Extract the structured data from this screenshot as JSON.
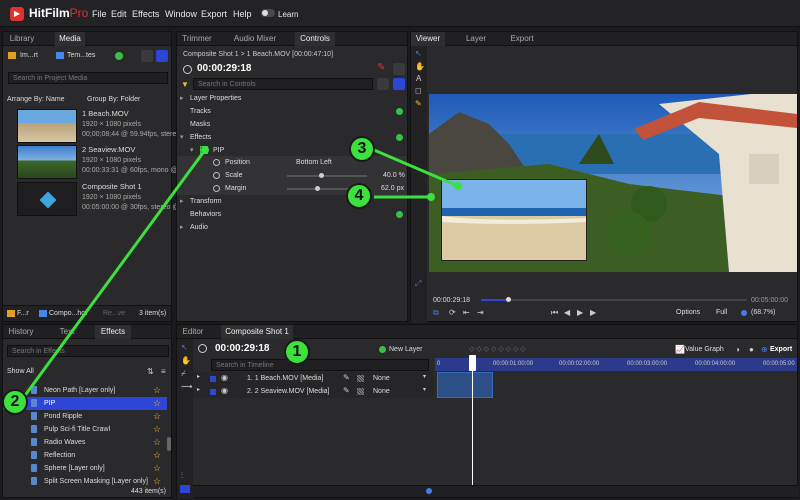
{
  "app": {
    "name": "HitFilm",
    "edition": "Pro",
    "logo_glyph": "▶"
  },
  "menu": [
    "File",
    "Edit",
    "Effects",
    "Window",
    "Export",
    "Help"
  ],
  "learn": {
    "label": "Learn",
    "enabled": false
  },
  "media_panel": {
    "tabs": [
      "Library",
      "Media"
    ],
    "tool_buttons": [
      "Im...rt",
      "Tem...tes"
    ],
    "search_placeholder": "Search in Project Media",
    "arrange_label": "Arrange By: Name",
    "group_label": "Group By: Folder",
    "items": [
      {
        "name": "1 Beach.MOV",
        "line1": "1920 × 1080 pixels",
        "line2": "00;00;08;44 @ 59.94fps, stereo"
      },
      {
        "name": "2 Seaview.MOV",
        "line1": "1920 × 1080 pixels",
        "line2": "00:00:33:31 @ 60fps, mono @ 4"
      },
      {
        "name": "Composite Shot 1",
        "line1": "1920 × 1080 pixels",
        "line2": "00:05:00:00 @ 30fps, stereo @"
      }
    ],
    "footer_buttons": [
      "F...r",
      "Compo...hot",
      "Re...ve"
    ],
    "count": "3 item(s)"
  },
  "controls_panel": {
    "tabs": [
      "Trimmer",
      "Audio Mixer",
      "Controls"
    ],
    "breadcrumb": "Composite Shot 1 > 1 Beach.MOV [00:00:47:10]",
    "timecode": "00:00:29:18",
    "search_placeholder": "Search in Controls",
    "sections": {
      "layer_properties": "Layer Properties",
      "tracks": "Tracks",
      "masks": "Masks",
      "effects": "Effects",
      "transform": "Transform",
      "behaviors": "Behaviors",
      "audio": "Audio"
    },
    "pip": {
      "label": "PIP",
      "checked": true,
      "position_label": "Position",
      "position_value": "Bottom Left",
      "scale_label": "Scale",
      "scale_value": "40.0 %",
      "scale_level_pct": 40,
      "margin_label": "Margin",
      "margin_value": "62.0 px",
      "margin_level_pct": 35
    }
  },
  "viewer": {
    "tabs": [
      "Viewer",
      "Layer",
      "Export"
    ],
    "timecode": "00:00:29:18",
    "end_time": "00:05:00:00",
    "playhead_pct": 10,
    "options": "Options",
    "quality": "Full",
    "zoom": "(68.7%)"
  },
  "effects_panel": {
    "tabs": [
      "History",
      "Text",
      "Effects"
    ],
    "search_placeholder": "Search in Effects",
    "show_label": "Show All",
    "items": [
      "Neon Path [Layer only]",
      "PIP",
      "Pond Ripple",
      "Pulp Sci-fi Title Crawl",
      "Radio Waves",
      "Reflection",
      "Sphere [Layer only]",
      "Split Screen Masking [Layer only]"
    ],
    "selected": "PIP",
    "count": "443 item(s)"
  },
  "editor": {
    "tabs": [
      "Editor",
      "Composite Shot 1"
    ],
    "timecode": "00:00:29:18",
    "search_placeholder": "Search in Timeline",
    "new_layer": "New Layer",
    "value_graph": "Value Graph",
    "export": "Export",
    "ruler": [
      "00:00:01:00:00",
      "00:00:02:00:00",
      "00:00:03:00:00",
      "00:00:04:00:00",
      "00:00:05:00"
    ],
    "ruler_start": "0",
    "tracks": [
      {
        "name": "1. 1 Beach.MOV [Media]",
        "blend": "None"
      },
      {
        "name": "2. 2 Seaview.MOV [Media]",
        "blend": "None"
      }
    ]
  },
  "callouts": [
    "1",
    "2",
    "3",
    "4"
  ],
  "colors": {
    "accent": "#2d46d8",
    "brand_red": "#e03131",
    "callout_green": "#3de13d",
    "star": "#f0c030"
  }
}
